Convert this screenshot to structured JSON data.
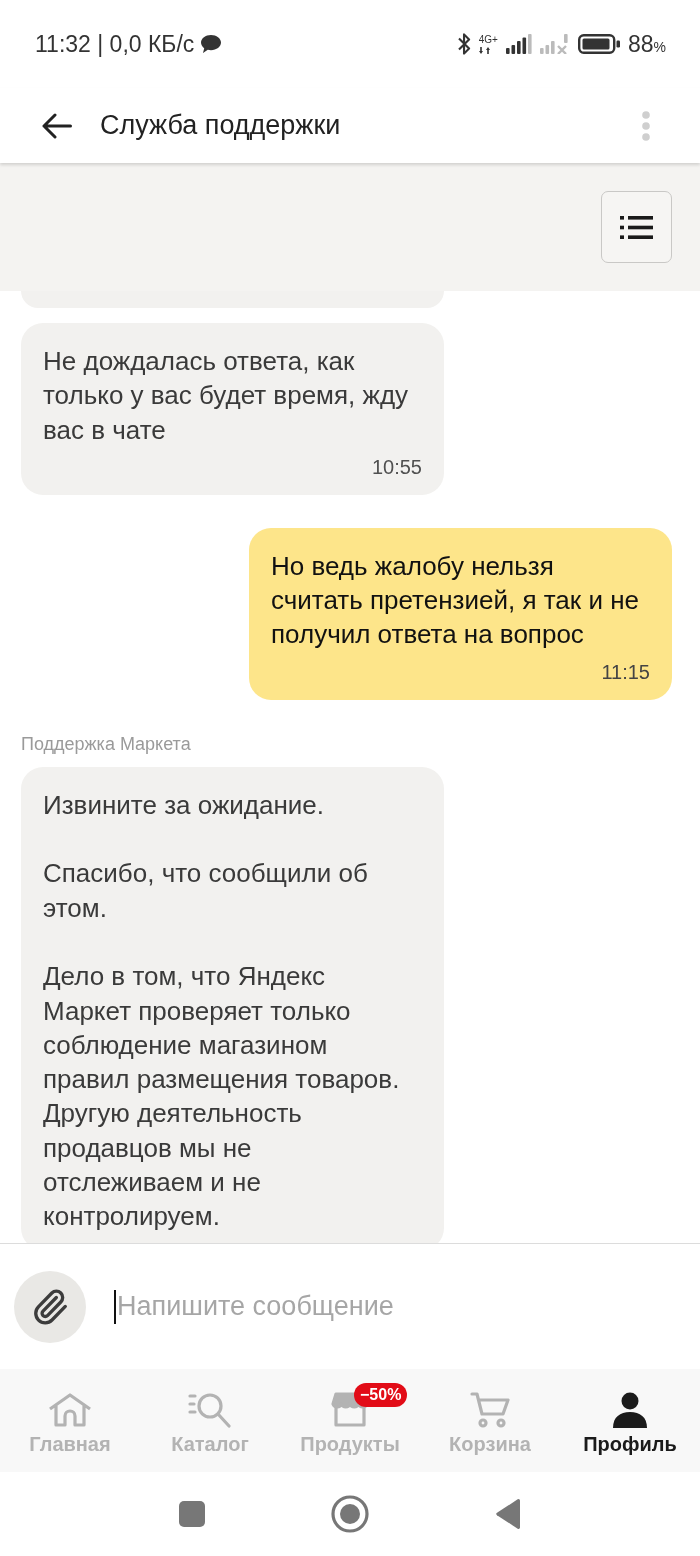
{
  "status_bar": {
    "text": "11:32 | 0,0 КБ/с",
    "network_type": "4G+",
    "battery_percent": "88",
    "battery_unit": "%"
  },
  "header": {
    "title": "Служба поддержки"
  },
  "messages": [
    {
      "kind": "incoming"
    },
    {
      "kind": "incoming",
      "paragraphs": [
        "Не дождалась ответа, как только у вас будет время, жду вас в чате"
      ],
      "time": "10:55"
    },
    {
      "kind": "outgoing",
      "paragraphs": [
        "Но ведь жалобу нельзя считать претензией, я так и не получил ответа на вопрос"
      ],
      "time": "11:15"
    },
    {
      "kind": "incoming",
      "sender": "Поддержка Маркета",
      "paragraphs": [
        "Извините за ожидание.",
        "Спасибо, что сообщили об этом.",
        "Дело в том, что Яндекс Маркет проверяет только соблюдение магазином правил размещения товаров. Другую деятельность продавцов мы не отслеживаем и не контролируем."
      ]
    }
  ],
  "composer": {
    "placeholder": "Напишите сообщение"
  },
  "tabs": [
    {
      "kind": "home",
      "label": "Главная",
      "selected": false
    },
    {
      "kind": "catalog",
      "label": "Каталог",
      "selected": false
    },
    {
      "kind": "products",
      "label": "Продукты",
      "selected": false,
      "badge": "−50%"
    },
    {
      "kind": "cart",
      "label": "Корзина",
      "selected": false
    },
    {
      "kind": "profile",
      "label": "Профиль",
      "selected": true
    }
  ]
}
